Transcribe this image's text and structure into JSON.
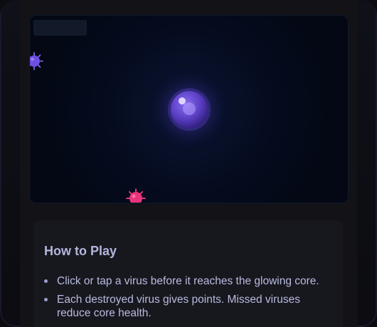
{
  "game": {
    "score_label": "",
    "core": {
      "state": "glowing"
    },
    "viruses": [
      {
        "color": "#7c5cf0",
        "name": "purple-virus"
      },
      {
        "color": "#e8337a",
        "name": "pink-virus"
      }
    ]
  },
  "how_to_play": {
    "title": "How to Play",
    "items": [
      "Click or tap a virus before it reaches the glowing core.",
      "Each destroyed virus gives points. Missed viruses reduce core health."
    ]
  },
  "colors": {
    "background": "#0d0d12",
    "panel": "#121217",
    "game_bg": "#030814",
    "core": "#5b3fc4",
    "text": "#b8bcdf"
  }
}
